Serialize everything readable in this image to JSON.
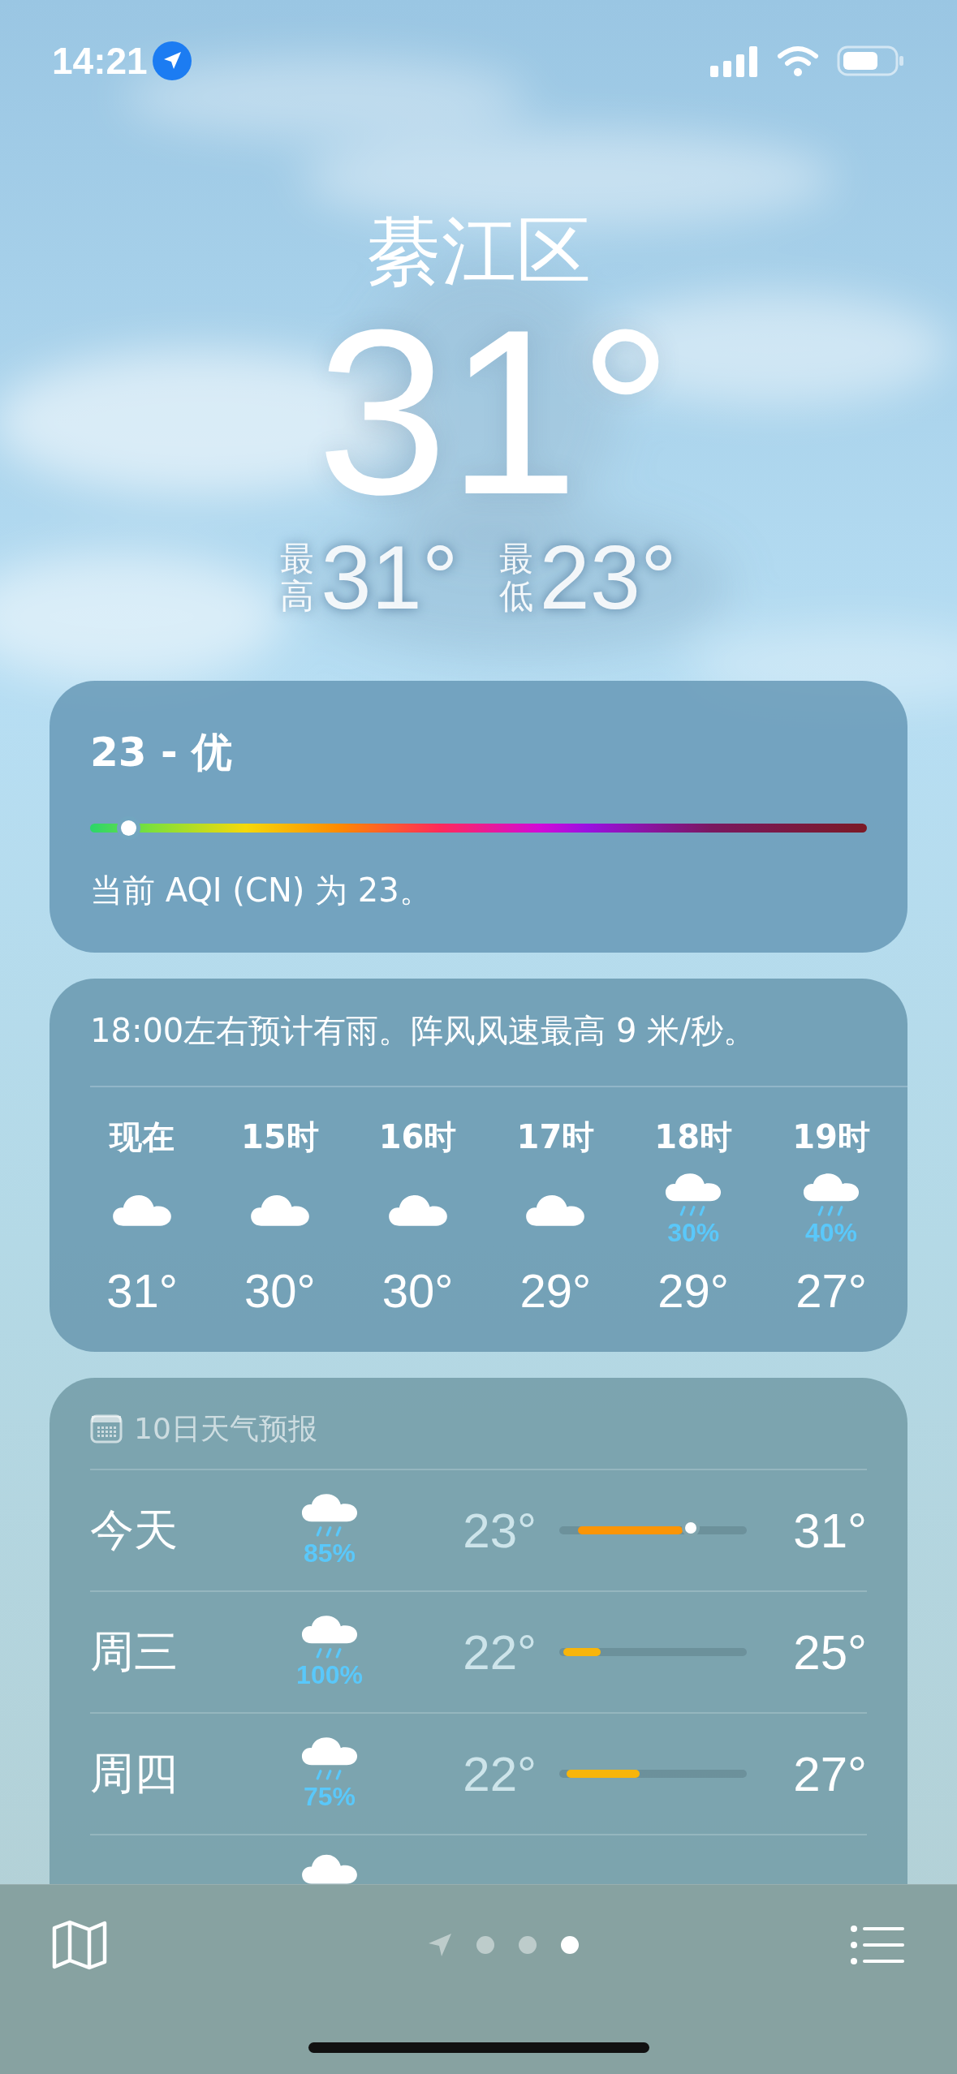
{
  "status_bar": {
    "time": "14:21"
  },
  "location": {
    "city": "綦江区",
    "temperature": "31°",
    "high_label": "最高",
    "high": "31°",
    "low_label": "最低",
    "low": "23°"
  },
  "aqi": {
    "title": "23 - 优",
    "marker": {
      "level": 0.05
    },
    "description": "当前 AQI (CN) 为 23。"
  },
  "hourly": {
    "summary": "18:00左右预计有雨。阵风风速最高 9 米/秒。",
    "hours": [
      {
        "label": "现在",
        "kind": "cloud",
        "temp": "31°"
      },
      {
        "label": "15时",
        "kind": "cloud",
        "temp": "30°"
      },
      {
        "label": "16时",
        "kind": "cloud",
        "temp": "30°"
      },
      {
        "label": "17时",
        "kind": "cloud",
        "temp": "29°"
      },
      {
        "label": "18时",
        "kind": "rain",
        "precip": "30%",
        "temp": "29°"
      },
      {
        "label": "19时",
        "kind": "rain",
        "precip": "40%",
        "temp": "27°"
      }
    ]
  },
  "ten_day": {
    "title": "10日天气预报",
    "days": [
      {
        "day": "今天",
        "kind": "rain",
        "precip": "85%",
        "low": "23°",
        "high": "31°",
        "bar": {
          "color": "#fb9506"
        },
        "now": {
          "level": 0.7
        }
      },
      {
        "day": "周三",
        "kind": "rain",
        "precip": "100%",
        "low": "22°",
        "high": "25°",
        "bar": {
          "color": "#f8b50a"
        }
      },
      {
        "day": "周四",
        "kind": "rain",
        "precip": "75%",
        "low": "22°",
        "high": "27°",
        "bar": {
          "color": "#f8b50a"
        }
      },
      {
        "kind": "cloud"
      }
    ]
  },
  "pages": [
    {
      "kind": "location",
      "selected": false
    },
    {
      "kind": "dot",
      "selected": false
    },
    {
      "kind": "dot",
      "selected": false
    },
    {
      "kind": "dot",
      "selected": true
    }
  ]
}
